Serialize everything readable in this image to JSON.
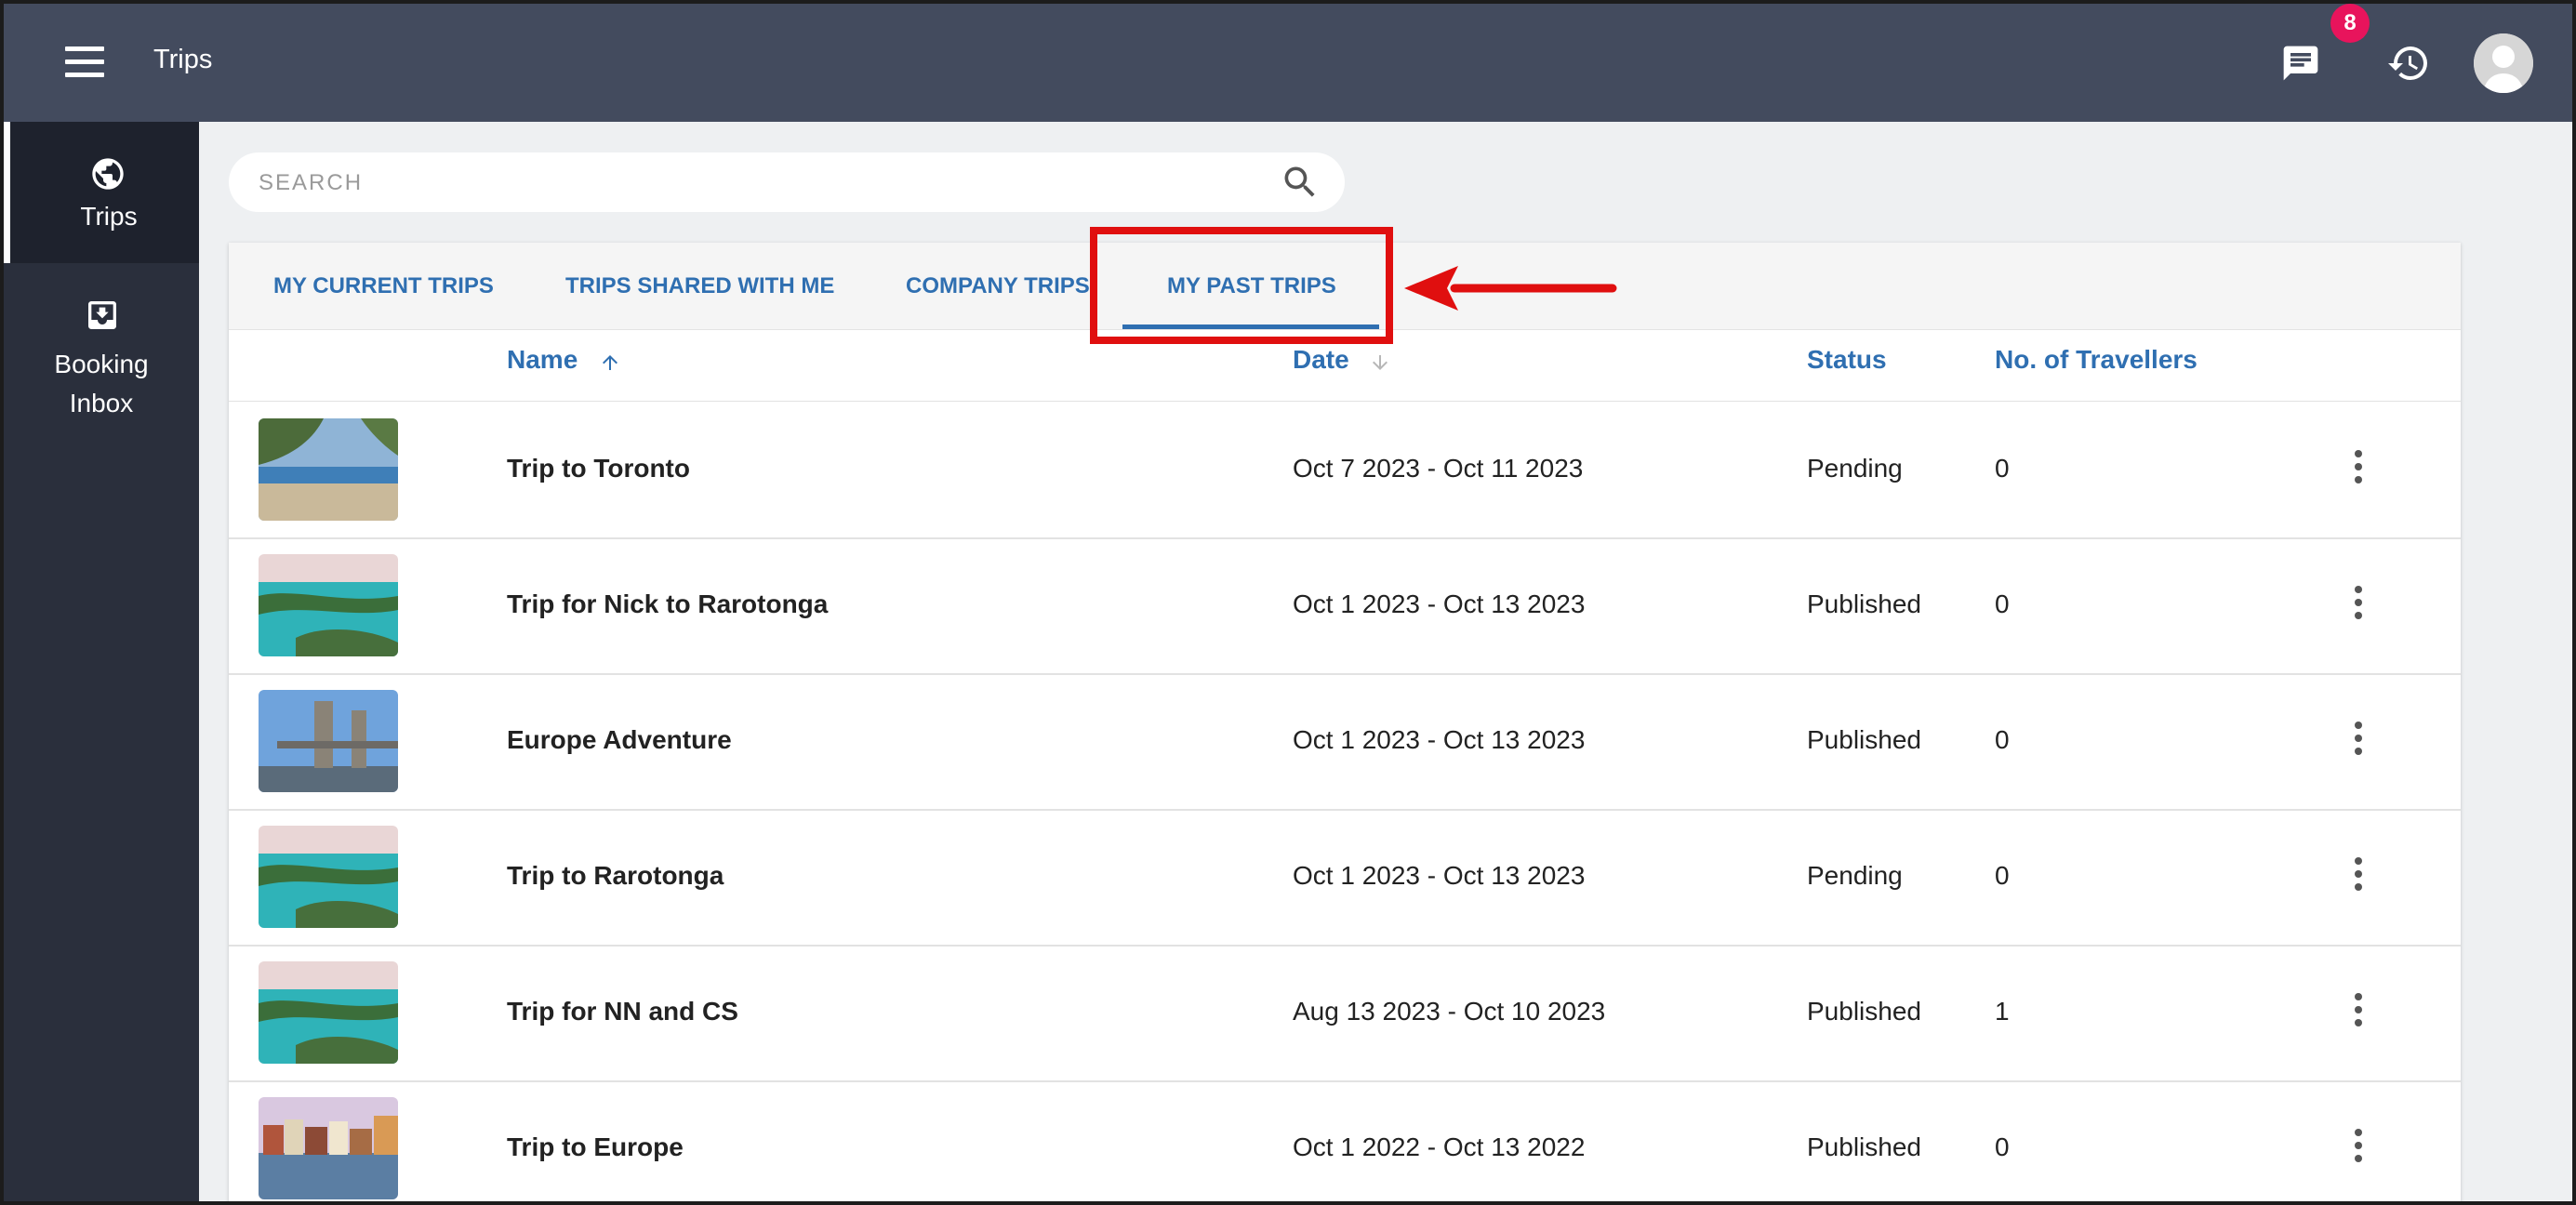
{
  "header": {
    "title": "Trips",
    "notification_count": "8",
    "icons": [
      "menu-icon",
      "chat-icon",
      "history-icon",
      "avatar"
    ]
  },
  "sidebar": {
    "items": [
      {
        "label": "Trips",
        "icon": "globe-icon",
        "active": true
      },
      {
        "label_line1": "Booking",
        "label_line2": "Inbox",
        "icon": "inbox-download-icon",
        "active": false
      }
    ]
  },
  "search": {
    "placeholder": "SEARCH",
    "value": ""
  },
  "tabs": [
    {
      "label": "MY CURRENT TRIPS",
      "active": false
    },
    {
      "label": "TRIPS SHARED WITH ME",
      "active": false
    },
    {
      "label": "COMPANY TRIPS",
      "active": false
    },
    {
      "label": "MY PAST TRIPS",
      "active": true
    }
  ],
  "table": {
    "columns": {
      "name": "Name",
      "date": "Date",
      "status": "Status",
      "travellers": "No. of Travellers"
    },
    "sort": {
      "name": "ascending",
      "date": "descending-inactive"
    },
    "rows": [
      {
        "name": "Trip to Toronto",
        "date": "Oct 7 2023 - Oct 11 2023",
        "status": "Pending",
        "travellers": "0",
        "thumb": "beach"
      },
      {
        "name": "Trip for Nick to Rarotonga",
        "date": "Oct 1 2023 - Oct 13 2023",
        "status": "Published",
        "travellers": "0",
        "thumb": "lagoon"
      },
      {
        "name": "Europe Adventure",
        "date": "Oct 1 2023 - Oct 13 2023",
        "status": "Published",
        "travellers": "0",
        "thumb": "bridge"
      },
      {
        "name": "Trip to Rarotonga",
        "date": "Oct 1 2023 - Oct 13 2023",
        "status": "Pending",
        "travellers": "0",
        "thumb": "lagoon"
      },
      {
        "name": "Trip for NN and CS",
        "date": "Aug 13 2023 - Oct 10 2023",
        "status": "Published",
        "travellers": "1",
        "thumb": "lagoon"
      },
      {
        "name": "Trip to Europe",
        "date": "Oct 1 2022 - Oct 13 2022",
        "status": "Published",
        "travellers": "0",
        "thumb": "harbor"
      }
    ]
  },
  "colors": {
    "topbar": "#434b5e",
    "sidebar": "#2a2f3c",
    "accent": "#2f6fb1",
    "badge": "#e8145c",
    "annotation": "#e00f0f"
  }
}
